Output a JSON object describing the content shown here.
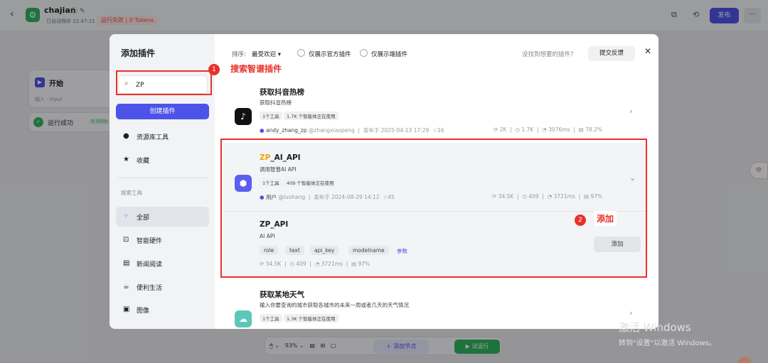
{
  "header": {
    "app_name": "chajian",
    "autosave": "已自动保存 22:47:21",
    "run_status": "运行失败 | 0 Tokens",
    "publish_label": "发布",
    "more_label": "···"
  },
  "canvas": {
    "start_node": {
      "title": "开始",
      "io_label": "输入",
      "io_value": "input"
    },
    "run_node": {
      "status": "运行成功",
      "time": "0.000s"
    },
    "bottom_bar": {
      "zoom": "93%",
      "add_node": "添加节点",
      "test_run": "试运行"
    },
    "side_button": "中"
  },
  "modal": {
    "title": "添加插件",
    "search": {
      "value": "ZP",
      "placeholder": ""
    },
    "create_button": "创建插件",
    "nav": [
      {
        "icon": "user-icon",
        "label": "资源库工具"
      },
      {
        "icon": "star-icon",
        "label": "收藏"
      }
    ],
    "section_title": "探索工具",
    "categories": [
      {
        "icon": "grid-icon",
        "label": "全部",
        "active": true
      },
      {
        "icon": "chip-icon",
        "label": "智能硬件"
      },
      {
        "icon": "news-icon",
        "label": "新闻阅读"
      },
      {
        "icon": "cup-icon",
        "label": "便利生活"
      },
      {
        "icon": "image-icon",
        "label": "图像"
      }
    ],
    "toolbar": {
      "sort_label": "排序:",
      "sort_value": "最受欢迎 ▾",
      "official_only": "仅展示官方插件",
      "endside_only": "仅展示端插件",
      "not_found": "没找到想要的插件?",
      "feedback": "提交反馈"
    },
    "plugins": [
      {
        "name": "获取抖音热榜",
        "desc": "获取抖音热榜",
        "tags": [
          "1个工具",
          "1.7K 个智能体正在使用"
        ],
        "author": "andy_zhang_zp",
        "handle": "@zhangxiaopeng",
        "published": "发布于 2025-04-13 17:29",
        "stars": "16",
        "stats": [
          "2K",
          "1.7K",
          "3076ms",
          "78.2%"
        ]
      },
      {
        "name_prefix": "ZP",
        "name_suffix": "_AI_API",
        "desc": "调用智普AI API",
        "tags": [
          "1个工具",
          "409 个智能体正在使用"
        ],
        "author": "用户",
        "handle": "@luohang",
        "published": "发布于 2024-08-29 14:12",
        "stars": "45",
        "stats": [
          "34.5K",
          "409",
          "3721ms",
          "97%"
        ],
        "tool": {
          "name": "ZP_API",
          "desc": "AI API",
          "params": [
            "role",
            "text",
            "api_key",
            "modelname"
          ],
          "params_link": "参数",
          "stats": [
            "34.5K",
            "409",
            "3721ms",
            "97%"
          ],
          "add_label": "添加"
        }
      },
      {
        "name": "获取某地天气",
        "desc": "输入你要查询的城市获取各城市的未来一周或者几天的天气情况",
        "tags": [
          "1个工具",
          "1.3K 个智能体正在使用"
        ]
      }
    ]
  },
  "annotations": [
    {
      "num": "1",
      "label": "搜索智谱插件"
    },
    {
      "num": "2",
      "label": "添加"
    }
  ],
  "watermark": {
    "line1": "激活 Windows",
    "line2": "转到\"设置\"以激活 Windows。"
  }
}
